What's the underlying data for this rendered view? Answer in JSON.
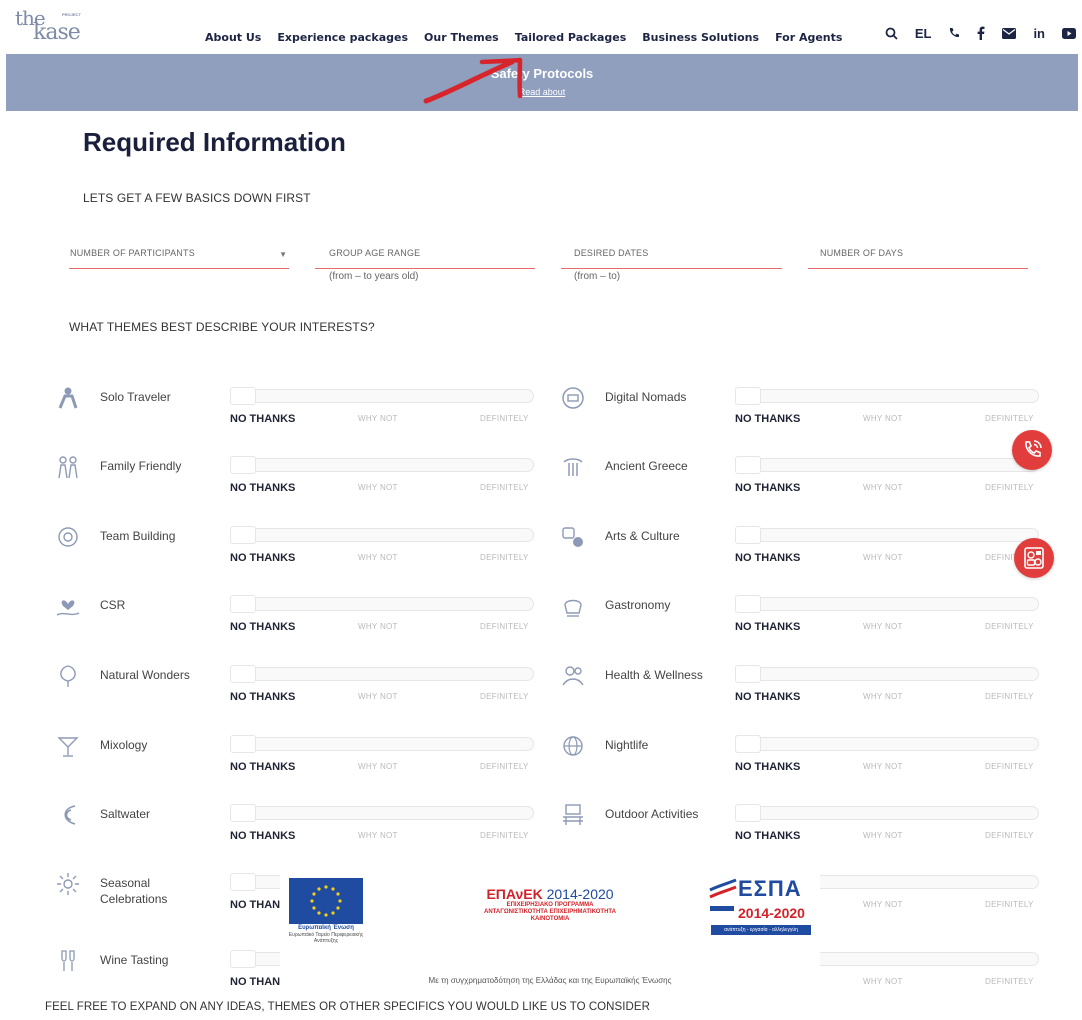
{
  "header": {
    "logo": {
      "the": "the",
      "project": "PROJECT",
      "kase": "kase"
    },
    "nav": [
      "About Us",
      "Experience packages",
      "Our Themes",
      "Tailored Packages",
      "Business Solutions",
      "For Agents"
    ],
    "lang": "EL",
    "icons": [
      "search-icon",
      "phone-icon",
      "facebook-icon",
      "mail-icon",
      "linkedin-icon",
      "youtube-icon"
    ],
    "linkedin_text": "in"
  },
  "banner": {
    "title": "Safety Protocols",
    "link": "Read about"
  },
  "form": {
    "title": "Required Information",
    "basics_label": "LETS GET A FEW BASICS DOWN FIRST",
    "fields": [
      {
        "label": "NUMBER OF PARTICIPANTS",
        "hint": ""
      },
      {
        "label": "GROUP AGE RANGE",
        "hint": "(from – to years old)"
      },
      {
        "label": "DESIRED DATES",
        "hint": "(from – to)"
      },
      {
        "label": "NUMBER OF DAYS",
        "hint": ""
      }
    ],
    "themes_label": "WHAT THEMES BEST DESCRIBE YOUR INTERESTS?",
    "scale": {
      "low": "NO THANKS",
      "mid": "WHY NOT",
      "high": "DEFINITELY"
    },
    "themes": [
      "Solo Traveler",
      "Digital Nomads",
      "Family Friendly",
      "Ancient Greece",
      "Team Building",
      "Arts & Culture",
      "CSR",
      "Gastronomy",
      "Natural Wonders",
      "Health & Wellness",
      "Mixology",
      "Nightlife",
      "Saltwater",
      "Outdoor Activities",
      "Seasonal Celebrations",
      "",
      "Wine Tasting",
      ""
    ],
    "expand_label": "FEEL FREE TO EXPAND ON ANY IDEAS, THEMES OR OTHER SPECIFICS YOU WOULD LIKE US TO CONSIDER"
  },
  "funding": {
    "eu_caption": "Ευρωπαϊκή Ένωση",
    "eu_caption2": "Ευρωπαϊκό Ταμείο Περιφερειακής Ανάπτυξης",
    "epanek_title": "ΕΠΑνΕΚ",
    "epanek_years": "2014-2020",
    "epanek_sub": "ΕΠΙΧΕΙΡΗΣΙΑΚΟ ΠΡΟΓΡΑΜΜΑ ΑΝΤΑΓΩΝΙΣΤΙΚΟΤΗΤΑ ΕΠΙΧΕΙΡΗΜΑΤΙΚΟΤΗΤΑ ΚΑΙΝΟΤΟΜΙΑ",
    "espa_title": "ΕΣΠΑ",
    "espa_years": "2014-2020",
    "espa_sub": "ανάπτυξη - εργασία - αλληλεγγύη",
    "caption": "Με τη συγχρηματοδότηση της Ελλάδας και της Ευρωπαϊκής Ένωσης"
  },
  "colors": {
    "accent": "#e23d3d",
    "banner": "#8f9fbd",
    "navy": "#1c2544"
  }
}
